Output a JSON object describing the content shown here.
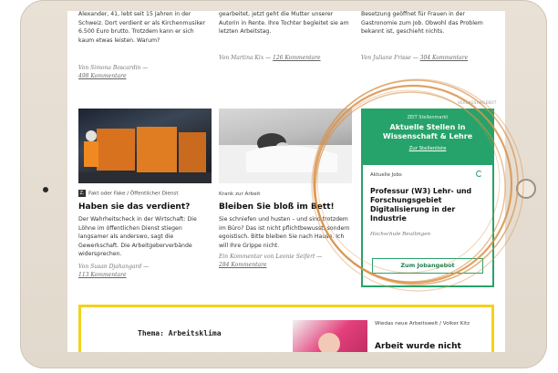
{
  "col1_top": {
    "text": "Alexander, 41, lebt seit 15 Jahren in der Schweiz. Dort verdient er als Kirchenmusiker 6.500 Euro brutto. Trotzdem kann er sich kaum etwas leisten. Warum?",
    "author": "Von Simona Boscardin",
    "comments": "498 Kommentare"
  },
  "col2_top": {
    "text": "gearbeitet, jetzt geht die Mutter unserer Autorin in Rente. Ihre Tochter begleitet sie am letzten Arbeitstag.",
    "author": "Von Martina Kix",
    "comments": "126 Kommentare"
  },
  "col3_top": {
    "text": "Besetzung geöffnet für Frauen in der Gastronomie zum Job. Obwohl das Problem bekannt ist, geschieht nichts.",
    "author": "Von Juliane Frisse",
    "comments": "304 Kommentare"
  },
  "ad_label": "VERLAGSANGEBOT",
  "article1": {
    "logo": "Z.",
    "kicker": "Fakt oder Fake / Öffentlicher Dienst",
    "headline": "Haben sie das verdient?",
    "text": "Der Wahrheitscheck in der Wirtschaft: Die Löhne im öffentlichen Dienst stiegen langsamer als anderswo, sagt die Gewerkschaft. Die Arbeitgeberverbände widersprechen.",
    "author": "Von Susan Djahangard",
    "comments": "113 Kommentare"
  },
  "article2": {
    "kicker": "Krank zur Arbeit",
    "headline": "Bleiben Sie bloß im Bett!",
    "text": "Sie schniefen und husten – und sind trotzdem im Büro? Das ist nicht pflichtbewusst, sondern egoistisch. Bitte bleiben Sie nach Hause. Ich will Ihre Grippe nicht.",
    "author": "Ein Kommentar von Leonie Seifert",
    "comments": "284 Kommentare"
  },
  "jobs": {
    "brand": "ZEIT Stellenmarkt",
    "title": "Aktuelle Stellen in Wissenschaft & Lehre",
    "link": "Zur Stellenliste",
    "section": "Aktuelle Jobs",
    "job_title": "Professur (W3) Lehr- und Forschungsgebiet Digitalisierung in der Industrie",
    "employer": "Hochschule Reutlingen",
    "button": "Zum Jobangebot"
  },
  "theme": {
    "label": "Thema: Arbeitsklima",
    "kicker": "Wiedas neue Arbeitswelt / Volker Kitz",
    "headline": "Arbeit wurde nicht"
  },
  "colors": {
    "accent_green": "#26a36a",
    "theme_yellow": "#f2d21b",
    "ring_orange": "#d9924a"
  }
}
